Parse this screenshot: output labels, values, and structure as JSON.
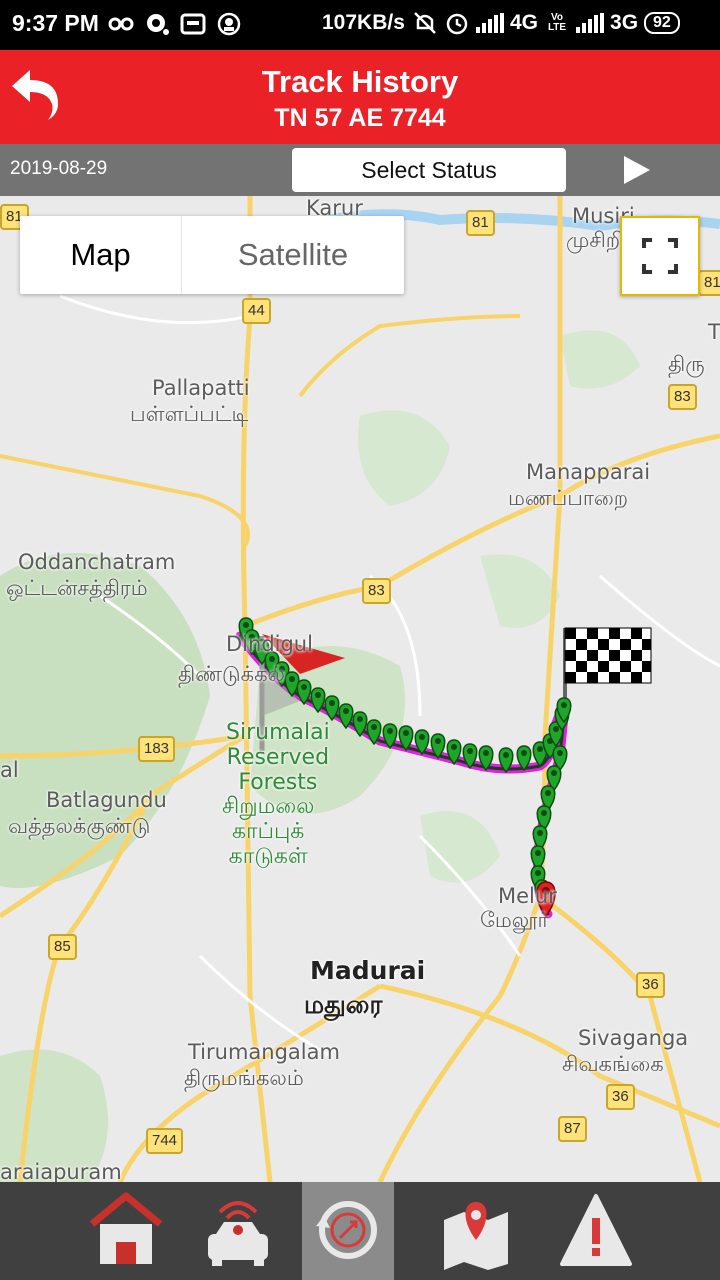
{
  "status_bar": {
    "time": "9:37 PM",
    "speed": "107KB/s",
    "net1": "4G",
    "lte": "Vo LTE",
    "net2": "3G",
    "battery": "92"
  },
  "header": {
    "title": "Track History",
    "vehicle": "TN 57 AE 7744"
  },
  "filter": {
    "date": "2019-08-29",
    "select_status_label": "Select Status"
  },
  "map": {
    "type_map": "Map",
    "type_satellite": "Satellite",
    "places": {
      "karur": "Karur",
      "musiri_en": "Musiri",
      "musiri_ta": "முசிறி",
      "pallapatti_en": "Pallapatti",
      "pallapatti_ta": "பள்ளப்பட்டி",
      "manapparai_en": "Manapparai",
      "manapparai_ta": "மணப்பாறை",
      "oddanchatram_en": "Oddanchatram",
      "oddanchatram_ta": "ஒட்டன்சத்திரம்",
      "dindigul_en": "Dindigul",
      "dindigul_ta": "திண்டுக்கல்",
      "sirumalai_en": "Sirumalai\nReserved\nForests",
      "sirumalai_ta": "சிறுமலை\nகாப்புக்\nகாடுகள்",
      "batlagundu_en": "Batlagundu",
      "batlagundu_ta": "வத்தலக்குண்டு",
      "melur_en": "Melur",
      "melur_ta": "மேலூர்",
      "madurai_en": "Madurai",
      "madurai_ta": "மதுரை",
      "sivaganga_en": "Sivaganga",
      "sivaganga_ta": "சிவகங்கை",
      "tirumangalam_en": "Tirumangalam",
      "tirumangalam_ta": "திருமங்கலம்",
      "rajapuram": "araiapuram",
      "tiru_partial": "திரு",
      "t_partial": "T",
      "al_partial": "al"
    },
    "road_shields": [
      "81",
      "81",
      "81",
      "44",
      "83",
      "83",
      "183",
      "85",
      "36",
      "36",
      "87",
      "744"
    ]
  },
  "bottom_nav": {
    "items": [
      "home-icon",
      "live-tracking-icon",
      "track-history-icon",
      "map-location-icon",
      "alert-icon"
    ],
    "active": "track-history-icon"
  },
  "colors": {
    "header_red": "#ea2227",
    "filter_gray": "#737373",
    "nav_dark": "#404040",
    "route_magenta": "#e21ee2",
    "marker_green": "#1fa52a"
  }
}
